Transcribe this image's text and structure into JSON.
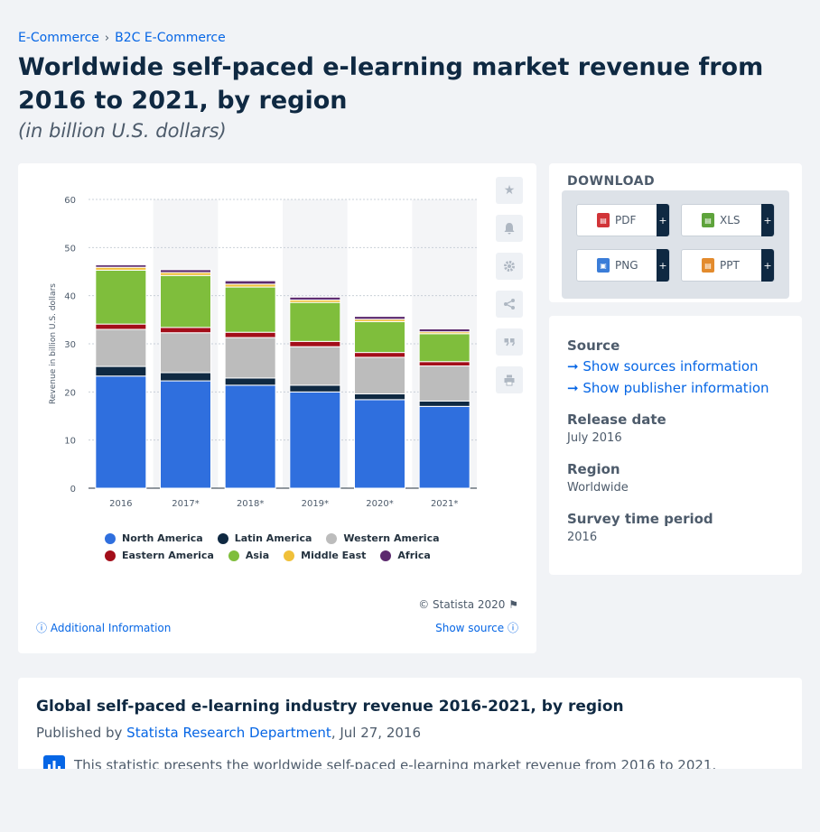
{
  "breadcrumb": {
    "item1": "E-Commerce",
    "separator": "›",
    "item2": "B2C E-Commerce"
  },
  "title": "Worldwide self-paced e-learning market revenue from 2016 to 2021, by region",
  "subtitle": "(in billion U.S. dollars)",
  "chart_data": {
    "type": "bar",
    "stacked": true,
    "categories": [
      "2016",
      "2017*",
      "2018*",
      "2019*",
      "2020*",
      "2021*"
    ],
    "ylabel": "Revenue in billion U.S. dollars",
    "ylim": [
      0,
      60
    ],
    "yticks": [
      0,
      10,
      20,
      30,
      40,
      50,
      60
    ],
    "legend_position": "bottom",
    "series": [
      {
        "name": "North America",
        "color": "#2f6fde",
        "values": [
          23.3,
          22.3,
          21.4,
          20.0,
          18.4,
          17.0
        ]
      },
      {
        "name": "Latin America",
        "color": "#0f2942",
        "values": [
          2.0,
          1.7,
          1.5,
          1.4,
          1.2,
          1.1
        ]
      },
      {
        "name": "Western America",
        "color": "#bcbcbc",
        "values": [
          7.7,
          8.3,
          8.4,
          8.0,
          7.6,
          7.3
        ]
      },
      {
        "name": "Eastern America",
        "color": "#a30e1a",
        "values": [
          1.1,
          1.1,
          1.1,
          1.1,
          1.0,
          0.9
        ]
      },
      {
        "name": "Asia",
        "color": "#7fbe3c",
        "values": [
          11.2,
          10.8,
          9.4,
          8.1,
          6.4,
          5.8
        ]
      },
      {
        "name": "Middle East",
        "color": "#f0c039",
        "values": [
          0.6,
          0.6,
          0.6,
          0.5,
          0.5,
          0.4
        ]
      },
      {
        "name": "Africa",
        "color": "#5c2a6e",
        "values": [
          0.5,
          0.6,
          0.7,
          0.6,
          0.6,
          0.6
        ]
      }
    ]
  },
  "chart_footer": {
    "copyright": "© Statista 2020",
    "additional_info": "Additional Information",
    "show_source": "Show source"
  },
  "download": {
    "title": "DOWNLOAD",
    "buttons": [
      {
        "label": "PDF",
        "color": "#d13438"
      },
      {
        "label": "XLS",
        "color": "#5ea33b"
      },
      {
        "label": "PNG",
        "color": "#3b7dd8"
      },
      {
        "label": "PPT",
        "color": "#e38b2d"
      }
    ],
    "plus": "+"
  },
  "meta": {
    "source_label": "Source",
    "show_sources": "Show sources information",
    "show_publisher": "Show publisher information",
    "release_label": "Release date",
    "release_value": "July 2016",
    "region_label": "Region",
    "region_value": "Worldwide",
    "survey_label": "Survey time period",
    "survey_value": "2016"
  },
  "description": {
    "title": "Global self-paced e-learning industry revenue 2016-2021, by region",
    "published_prefix": "Published by",
    "publisher": "Statista Research Department",
    "date": ", Jul 27, 2016",
    "text": "This statistic presents the worldwide self-paced e-learning market revenue from 2016 to 2021."
  }
}
